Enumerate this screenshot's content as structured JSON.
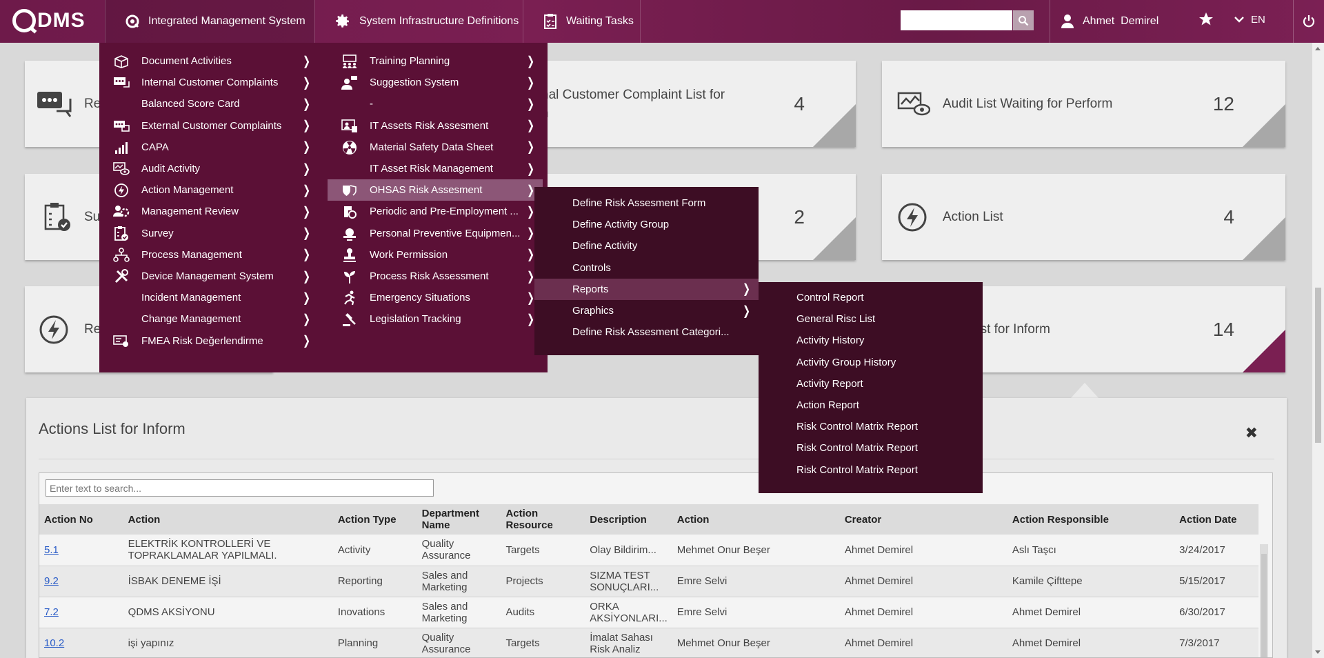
{
  "topbar": {
    "logo": "QDMS",
    "nav": [
      {
        "label": "Integrated Management System",
        "icon": "qdms-circle-icon"
      },
      {
        "label": "System Infrastructure Definitions",
        "icon": "gear-icon"
      },
      {
        "label": "Waiting Tasks",
        "icon": "clipboard-icon"
      }
    ],
    "search_placeholder": "",
    "user": "Ahmet  Demirel",
    "language": "EN"
  },
  "cards": [
    {
      "title": "Re",
      "count": "",
      "icon": "feedback-chat-icon"
    },
    {
      "title": "nal Customer Complaint List for\nn",
      "count": "4",
      "icon": ""
    },
    {
      "title": "Audit List Waiting for Perform",
      "count": "12",
      "icon": "audit-eye-chart-icon"
    },
    {
      "title": "Su",
      "count": "",
      "icon": "survey-clipboard-icon"
    },
    {
      "title": "",
      "count": "2",
      "icon": ""
    },
    {
      "title": "Action List",
      "count": "4",
      "icon": "lightning-circle-icon"
    },
    {
      "title": "Re",
      "count": "",
      "icon": "lightning-circle-icon"
    },
    {
      "title": "s List for Inform",
      "count": "14",
      "icon": ""
    }
  ],
  "menu": {
    "col1": [
      {
        "label": "Document Activities",
        "icon": "document-box-icon"
      },
      {
        "label": "Internal Customer Complaints",
        "icon": "chat-dots-icon"
      },
      {
        "label": "Balanced Score Card",
        "icon": ""
      },
      {
        "label": "External Customer Complaints",
        "icon": "chat-bubbles-icon"
      },
      {
        "label": "CAPA",
        "icon": "bar-chart-icon"
      },
      {
        "label": "Audit Activity",
        "icon": "audit-eye-icon"
      },
      {
        "label": "Action Management",
        "icon": "lightning-circle-icon"
      },
      {
        "label": "Management Review",
        "icon": "people-gear-icon"
      },
      {
        "label": "Survey",
        "icon": "survey-icon"
      },
      {
        "label": "Process Management",
        "icon": "process-tree-icon"
      },
      {
        "label": "Device Management System",
        "icon": "tools-icon"
      },
      {
        "label": "Incident Management",
        "icon": ""
      },
      {
        "label": "Change Management",
        "icon": ""
      },
      {
        "label": "FMEA Risk Değerlendirme",
        "icon": "fmea-icon"
      }
    ],
    "col2": [
      {
        "label": "Training Planning",
        "icon": "training-icon"
      },
      {
        "label": "Suggestion System",
        "icon": "suggestion-person-icon"
      },
      {
        "label": "-",
        "icon": ""
      },
      {
        "label": "IT Assets Risk Assesment",
        "icon": "it-risk-icon"
      },
      {
        "label": "Material Safety Data Sheet",
        "icon": "radiation-icon"
      },
      {
        "label": "IT Asset Risk Management",
        "icon": ""
      },
      {
        "label": "OHSAS Risk Assesment",
        "icon": "ohsas-shield-icon"
      },
      {
        "label": "Periodic and Pre-Employment ...",
        "icon": "medical-icon"
      },
      {
        "label": "Personal Preventive Equipmen...",
        "icon": "helmet-icon"
      },
      {
        "label": "Work Permission",
        "icon": "stamp-icon"
      },
      {
        "label": "Process Risk Assessment",
        "icon": "plant-icon"
      },
      {
        "label": "Emergency Situations",
        "icon": "running-person-icon"
      },
      {
        "label": "Legislation Tracking",
        "icon": "gavel-icon"
      }
    ],
    "ohsas_sub": [
      {
        "label": "Define Risk Assesment Form",
        "arrow": false
      },
      {
        "label": "Define Activity Group",
        "arrow": false
      },
      {
        "label": "Define Activity",
        "arrow": false
      },
      {
        "label": "Controls",
        "arrow": false
      },
      {
        "label": "Reports",
        "arrow": true
      },
      {
        "label": "Graphics",
        "arrow": true
      },
      {
        "label": "Define Risk Assesment Categori...",
        "arrow": false
      }
    ],
    "reports_sub": [
      "Control Report",
      "General Risc List",
      "Activity History",
      "Activity Group History",
      "Activity Report",
      "Action Report",
      "Risk Control Matrix Report",
      "Risk Control Matrix Report",
      "Risk Control Matrix Report"
    ]
  },
  "panel": {
    "title": "Actions List for Inform",
    "search_placeholder": "Enter text to search...",
    "columns": [
      "Action No",
      "Action",
      "Action Type",
      "Department Name",
      "Action Resource",
      "Description",
      "Action",
      "Creator",
      "Action Responsible",
      "Action Date"
    ],
    "rows": [
      [
        "5.1",
        "ELEKTRİK KONTROLLERİ VE TOPRAKLAMALAR YAPILMALI.",
        "Activity",
        "Quality Assurance",
        "Targets",
        "Olay Bildirim...",
        "Mehmet Onur Beşer",
        "Ahmet Demirel",
        "Aslı Taşcı",
        "3/24/2017"
      ],
      [
        "9.2",
        "İSBAK DENEME İŞİ",
        "Reporting",
        "Sales and Marketing",
        "Projects",
        "SIZMA TEST SONUÇLARI...",
        "Emre Selvi",
        "Ahmet Demirel",
        "Kamile Çifttepe",
        "5/15/2017"
      ],
      [
        "7.2",
        "QDMS AKSİYONU",
        "Inovations",
        "Sales and Marketing",
        "Audits",
        "ORKA AKSİYONLARI...",
        "Emre Selvi",
        "Ahmet Demirel",
        "Ahmet Demirel",
        "6/30/2017"
      ],
      [
        "10.2",
        "işi yapınız",
        "Planning",
        "Quality Assurance",
        "Targets",
        "İmalat Sahası Risk Analiz",
        "Mehmet Onur Beşer",
        "Ahmet Demirel",
        "Ahmet Demirel",
        "7/3/2017"
      ]
    ]
  },
  "colors": {
    "brand": "#7a1f52",
    "menu_bg": "#5b1036",
    "submenu_bg": "#3d0d24",
    "highlight": "#8c5677"
  }
}
